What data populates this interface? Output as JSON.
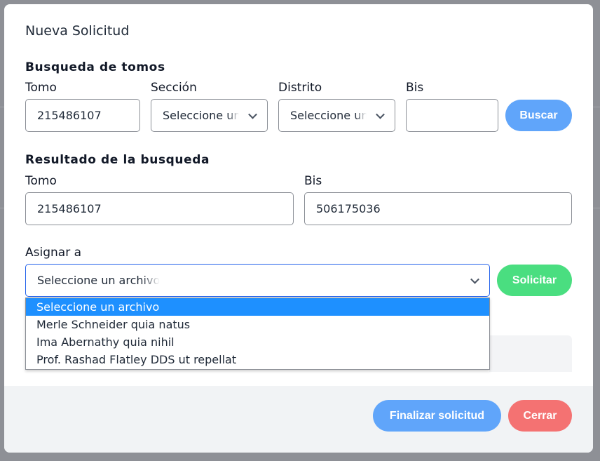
{
  "modal": {
    "title": "Nueva Solicitud"
  },
  "search": {
    "section_title": "Busqueda de tomos",
    "tomo_label": "Tomo",
    "tomo_value": "215486107",
    "seccion_label": "Sección",
    "seccion_value": "Seleccione un",
    "distrito_label": "Distrito",
    "distrito_value": "Seleccione un",
    "bis_label": "Bis",
    "bis_value": "",
    "buscar_label": "Buscar"
  },
  "result": {
    "section_title": "Resultado de la busqueda",
    "tomo_label": "Tomo",
    "tomo_value": "215486107",
    "bis_label": "Bis",
    "bis_value": "506175036"
  },
  "assign": {
    "label": "Asignar a",
    "selected_value": "Seleccione un archivo",
    "solicitar_label": "Solicitar",
    "options": [
      "Seleccione un archivo",
      "Merle Schneider quia natus",
      "Ima Abernathy quia nihil",
      "Prof. Rashad Flatley DDS ut repellat"
    ]
  },
  "footer": {
    "finalizar_label": "Finalizar solicitud",
    "cerrar_label": "Cerrar"
  },
  "colors": {
    "primary_button": "#60a5fa",
    "success_button": "#4ade80",
    "danger_button": "#f47272",
    "dropdown_highlight": "#1e90ff",
    "focus_border": "#2563eb"
  }
}
